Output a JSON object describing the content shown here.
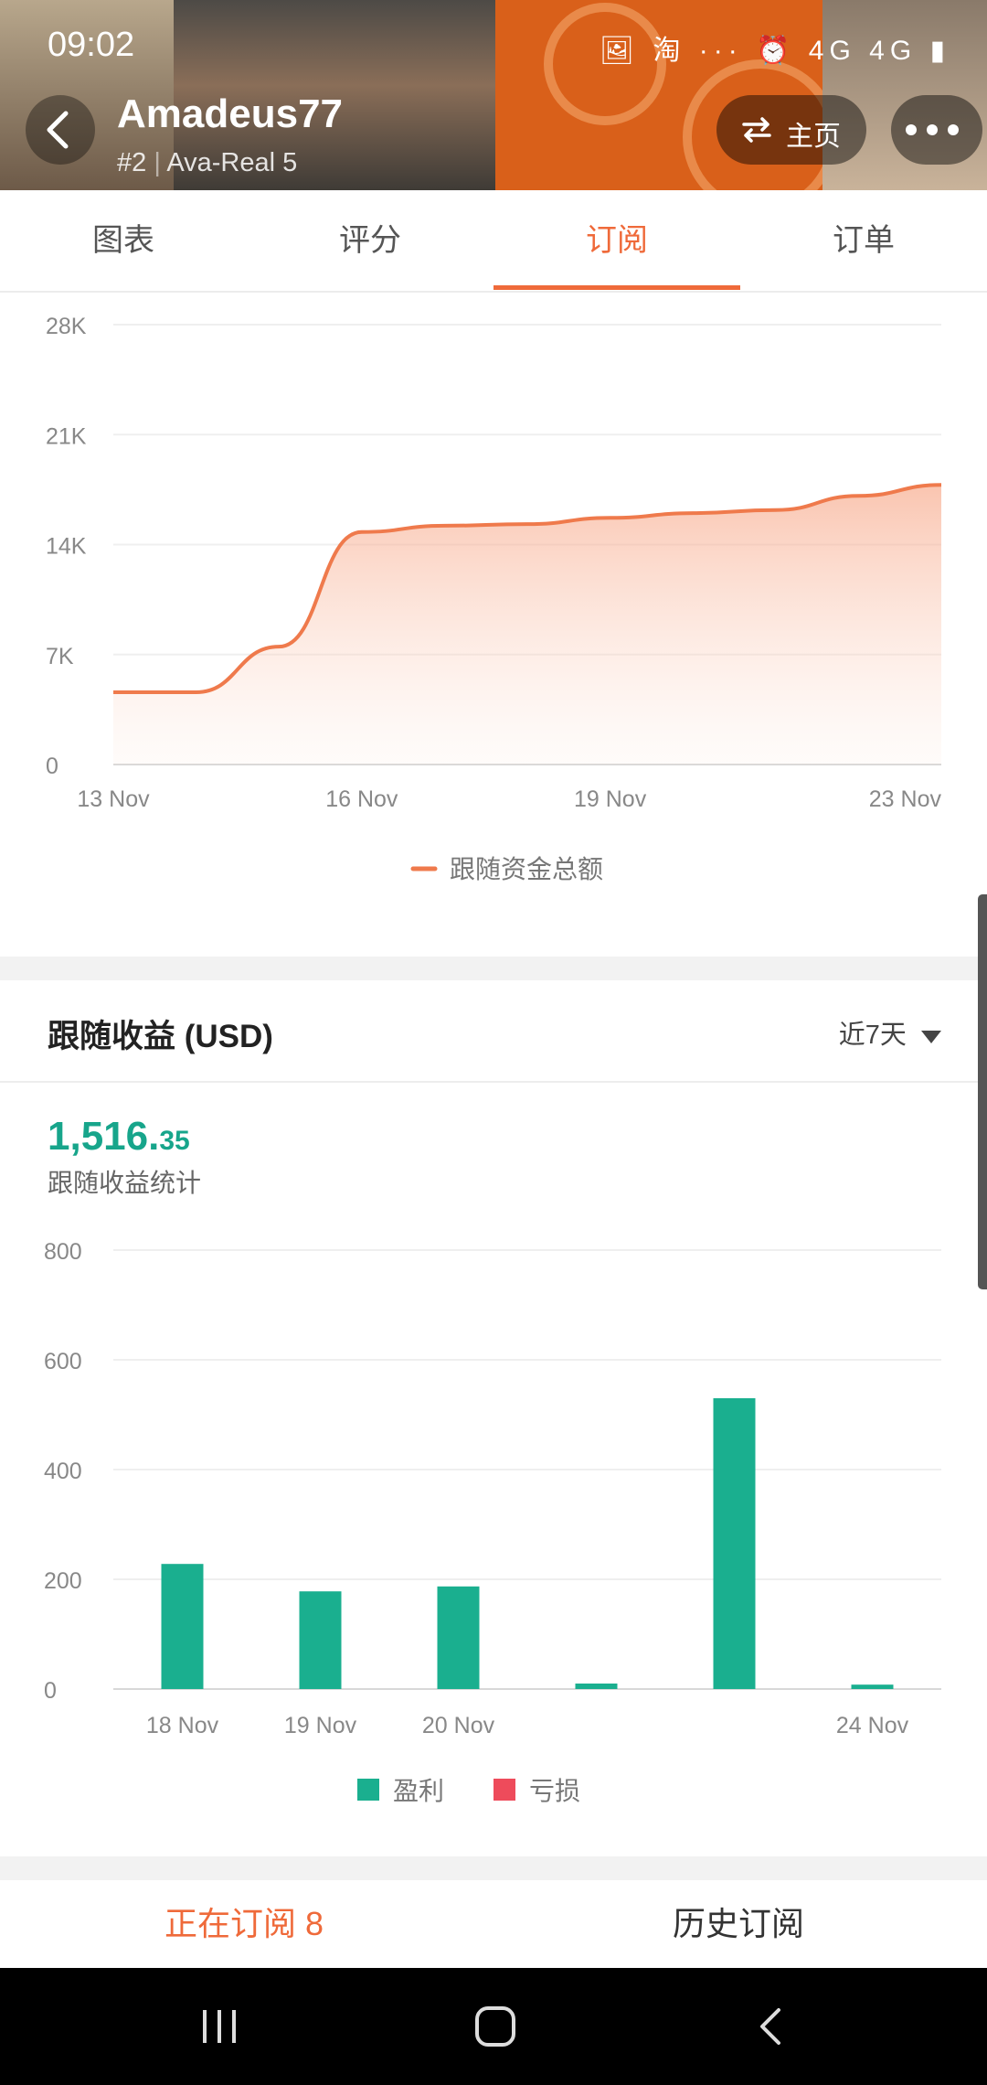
{
  "status_bar": {
    "time": "09:02",
    "icons": "🖼 淘 ··· ⏰ 4G 4G ▮"
  },
  "header": {
    "title": "Amadeus77",
    "rank": "#2",
    "account": "Ava-Real 5",
    "home_label": "主页"
  },
  "tabs": [
    {
      "label": "图表",
      "active": false
    },
    {
      "label": "评分",
      "active": false
    },
    {
      "label": "订阅",
      "active": true
    },
    {
      "label": "订单",
      "active": false
    }
  ],
  "chart_data": [
    {
      "type": "area",
      "x": [
        "13 Nov",
        "14 Nov",
        "15 Nov",
        "16 Nov",
        "17 Nov",
        "18 Nov",
        "19 Nov",
        "20 Nov",
        "21 Nov",
        "22 Nov",
        "23 Nov"
      ],
      "x_ticks": [
        "13 Nov",
        "16 Nov",
        "19 Nov",
        "23 Nov"
      ],
      "series": [
        {
          "name": "跟随资金总额",
          "values": [
            4600,
            4600,
            7500,
            14800,
            15200,
            15300,
            15700,
            16000,
            16200,
            17100,
            17800
          ]
        }
      ],
      "yticks": [
        "28K",
        "21K",
        "14K",
        "7K",
        "0"
      ],
      "ylim": [
        0,
        28000
      ],
      "grid": true,
      "legend": "bottom",
      "color": "#ef7a4c"
    },
    {
      "type": "bar",
      "title": "跟随收益 (USD)",
      "categories": [
        "18 Nov",
        "19 Nov",
        "20 Nov",
        "",
        "",
        "24 Nov"
      ],
      "series": [
        {
          "name": "盈利",
          "values": [
            228,
            178,
            187,
            10,
            530,
            8
          ],
          "color": "#1aaf8f"
        },
        {
          "name": "亏损",
          "values": [
            0,
            0,
            0,
            0,
            0,
            0
          ],
          "color": "#ee4b5b"
        }
      ],
      "yticks": [
        "800",
        "600",
        "400",
        "200",
        "0"
      ],
      "ylim": [
        0,
        800
      ],
      "grid": true,
      "legend": "bottom"
    }
  ],
  "earnings": {
    "title": "跟随收益 (USD)",
    "range_label": "近7天",
    "amount_int": "1,516.",
    "amount_dec": "35",
    "amount_label": "跟随收益统计"
  },
  "bottom_tabs": [
    {
      "label": "正在订阅 8",
      "active": true
    },
    {
      "label": "历史订阅",
      "active": false
    }
  ],
  "colors": {
    "accent": "#ef6a3a",
    "profit": "#1aaf8f",
    "loss": "#ee4b5b"
  }
}
